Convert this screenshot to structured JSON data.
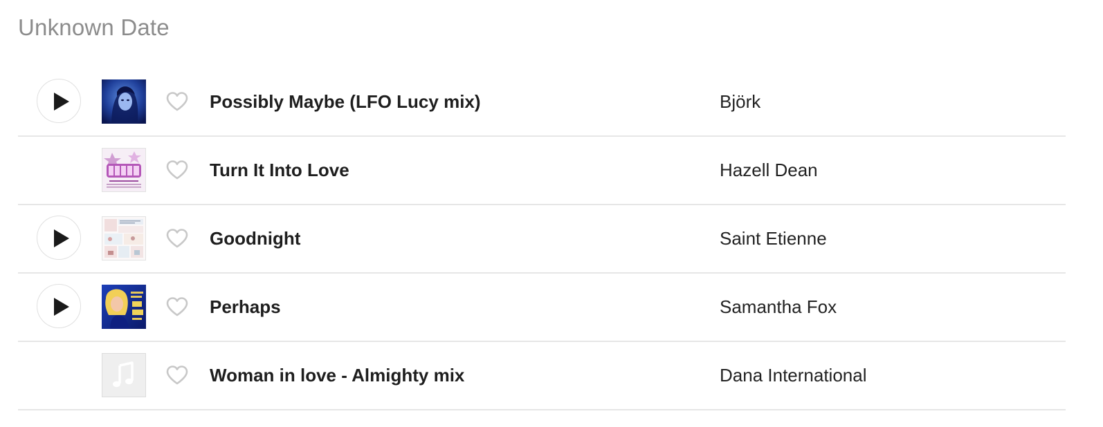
{
  "section": {
    "title": "Unknown Date"
  },
  "colors": {
    "title_gray": "#8c8c8c",
    "divider": "#e6e6e6",
    "heart_outline": "#c8c8c8",
    "play_glyph": "#1a1a1a"
  },
  "tracks": [
    {
      "title": "Possibly Maybe (LFO Lucy mix)",
      "artist": "Björk",
      "has_play_button": true,
      "play_icon": "play-icon",
      "favorite_icon": "heart-outline-icon",
      "cover": "album-cover-blue-portrait"
    },
    {
      "title": "Turn It Into Love",
      "artist": "Hazell Dean",
      "has_play_button": false,
      "favorite_icon": "heart-outline-icon",
      "cover": "album-cover-girls-compilation"
    },
    {
      "title": "Goodnight",
      "artist": "Saint Etienne",
      "has_play_button": true,
      "play_icon": "play-icon",
      "favorite_icon": "heart-outline-icon",
      "cover": "album-cover-illustrated-panels"
    },
    {
      "title": "Perhaps",
      "artist": "Samantha Fox",
      "has_play_button": true,
      "play_icon": "play-icon",
      "favorite_icon": "heart-outline-icon",
      "cover": "album-cover-samantha-fox"
    },
    {
      "title": "Woman in love - Almighty mix",
      "artist": "Dana International",
      "has_play_button": false,
      "favorite_icon": "heart-outline-icon",
      "cover": "music-note-placeholder-icon"
    }
  ]
}
